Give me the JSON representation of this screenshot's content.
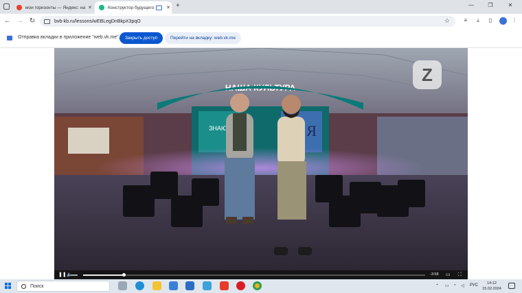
{
  "browser": {
    "tabs": [
      {
        "title": "мои горизонты — Яндекс: на",
        "active": false,
        "favicon_color": "#e8402b"
      },
      {
        "title": "Конструктор будущего",
        "active": true,
        "favicon_color": "#1bb98b"
      }
    ],
    "url": "bvb-kb.ru/lessons/wEBLegDnBkpX3pqO"
  },
  "infobar": {
    "message": "Отправка вкладки в приложение \"web.vk.me\"...",
    "primary_button": "Закрыть доступ",
    "secondary_button": "Перейти на вкладку: web.vk.me"
  },
  "video": {
    "stage_sign": "НАША КУЛЬТУРА",
    "screen_text_left": "ЗНАЮ",
    "screen_text_right": "и Я",
    "progress": 0.12,
    "duration": "-3:58",
    "colors": {
      "accent": "#0c7a78",
      "light": "#c07bf0"
    }
  },
  "taskbar": {
    "search_placeholder": "Поиск",
    "language": "РУС",
    "time": "14:12",
    "date": "15.02.2024"
  }
}
